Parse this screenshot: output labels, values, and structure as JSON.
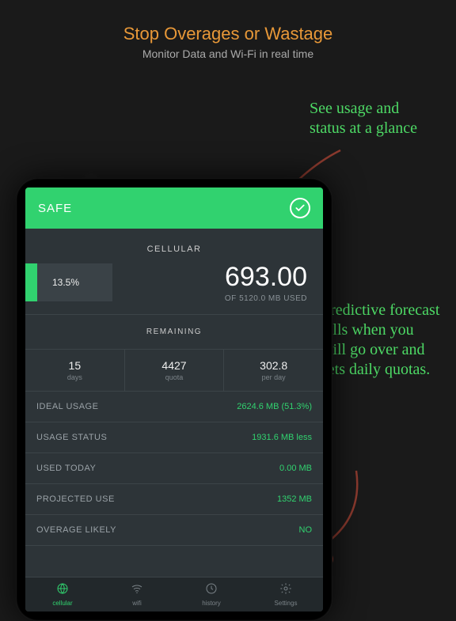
{
  "headline": "Stop Overages or Wastage",
  "subhead": "Monitor Data and Wi-Fi in real time",
  "annotations": {
    "a1": "See usage and status at a glance",
    "a2": "Predictive forecast tells when you will go over and sets daily quotas."
  },
  "topbar": {
    "status": "SAFE"
  },
  "usage": {
    "section": "CELLULAR",
    "percent_label": "13.5%",
    "bar_fill_pct": 13.5,
    "big_number": "693.00",
    "of_line": "OF 5120.0 MB USED"
  },
  "remaining": {
    "label": "REMAINING",
    "cells": [
      {
        "val": "15",
        "lbl": "days"
      },
      {
        "val": "4427",
        "lbl": "quota"
      },
      {
        "val": "302.8",
        "lbl": "per day"
      }
    ]
  },
  "stats": [
    {
      "label": "IDEAL USAGE",
      "val": "2624.6 MB (51.3%)"
    },
    {
      "label": "USAGE STATUS",
      "val": "1931.6 MB less"
    },
    {
      "label": "USED TODAY",
      "val": "0.00 MB"
    },
    {
      "label": "PROJECTED USE",
      "val": "1352 MB"
    },
    {
      "label": "OVERAGE LIKELY",
      "val": "NO"
    }
  ],
  "tabs": [
    {
      "label": "cellular",
      "icon": "globe-icon",
      "active": true
    },
    {
      "label": "wifi",
      "icon": "wifi-icon",
      "active": false
    },
    {
      "label": "history",
      "icon": "clock-icon",
      "active": false
    },
    {
      "label": "Settings",
      "icon": "gear-icon",
      "active": false
    }
  ]
}
